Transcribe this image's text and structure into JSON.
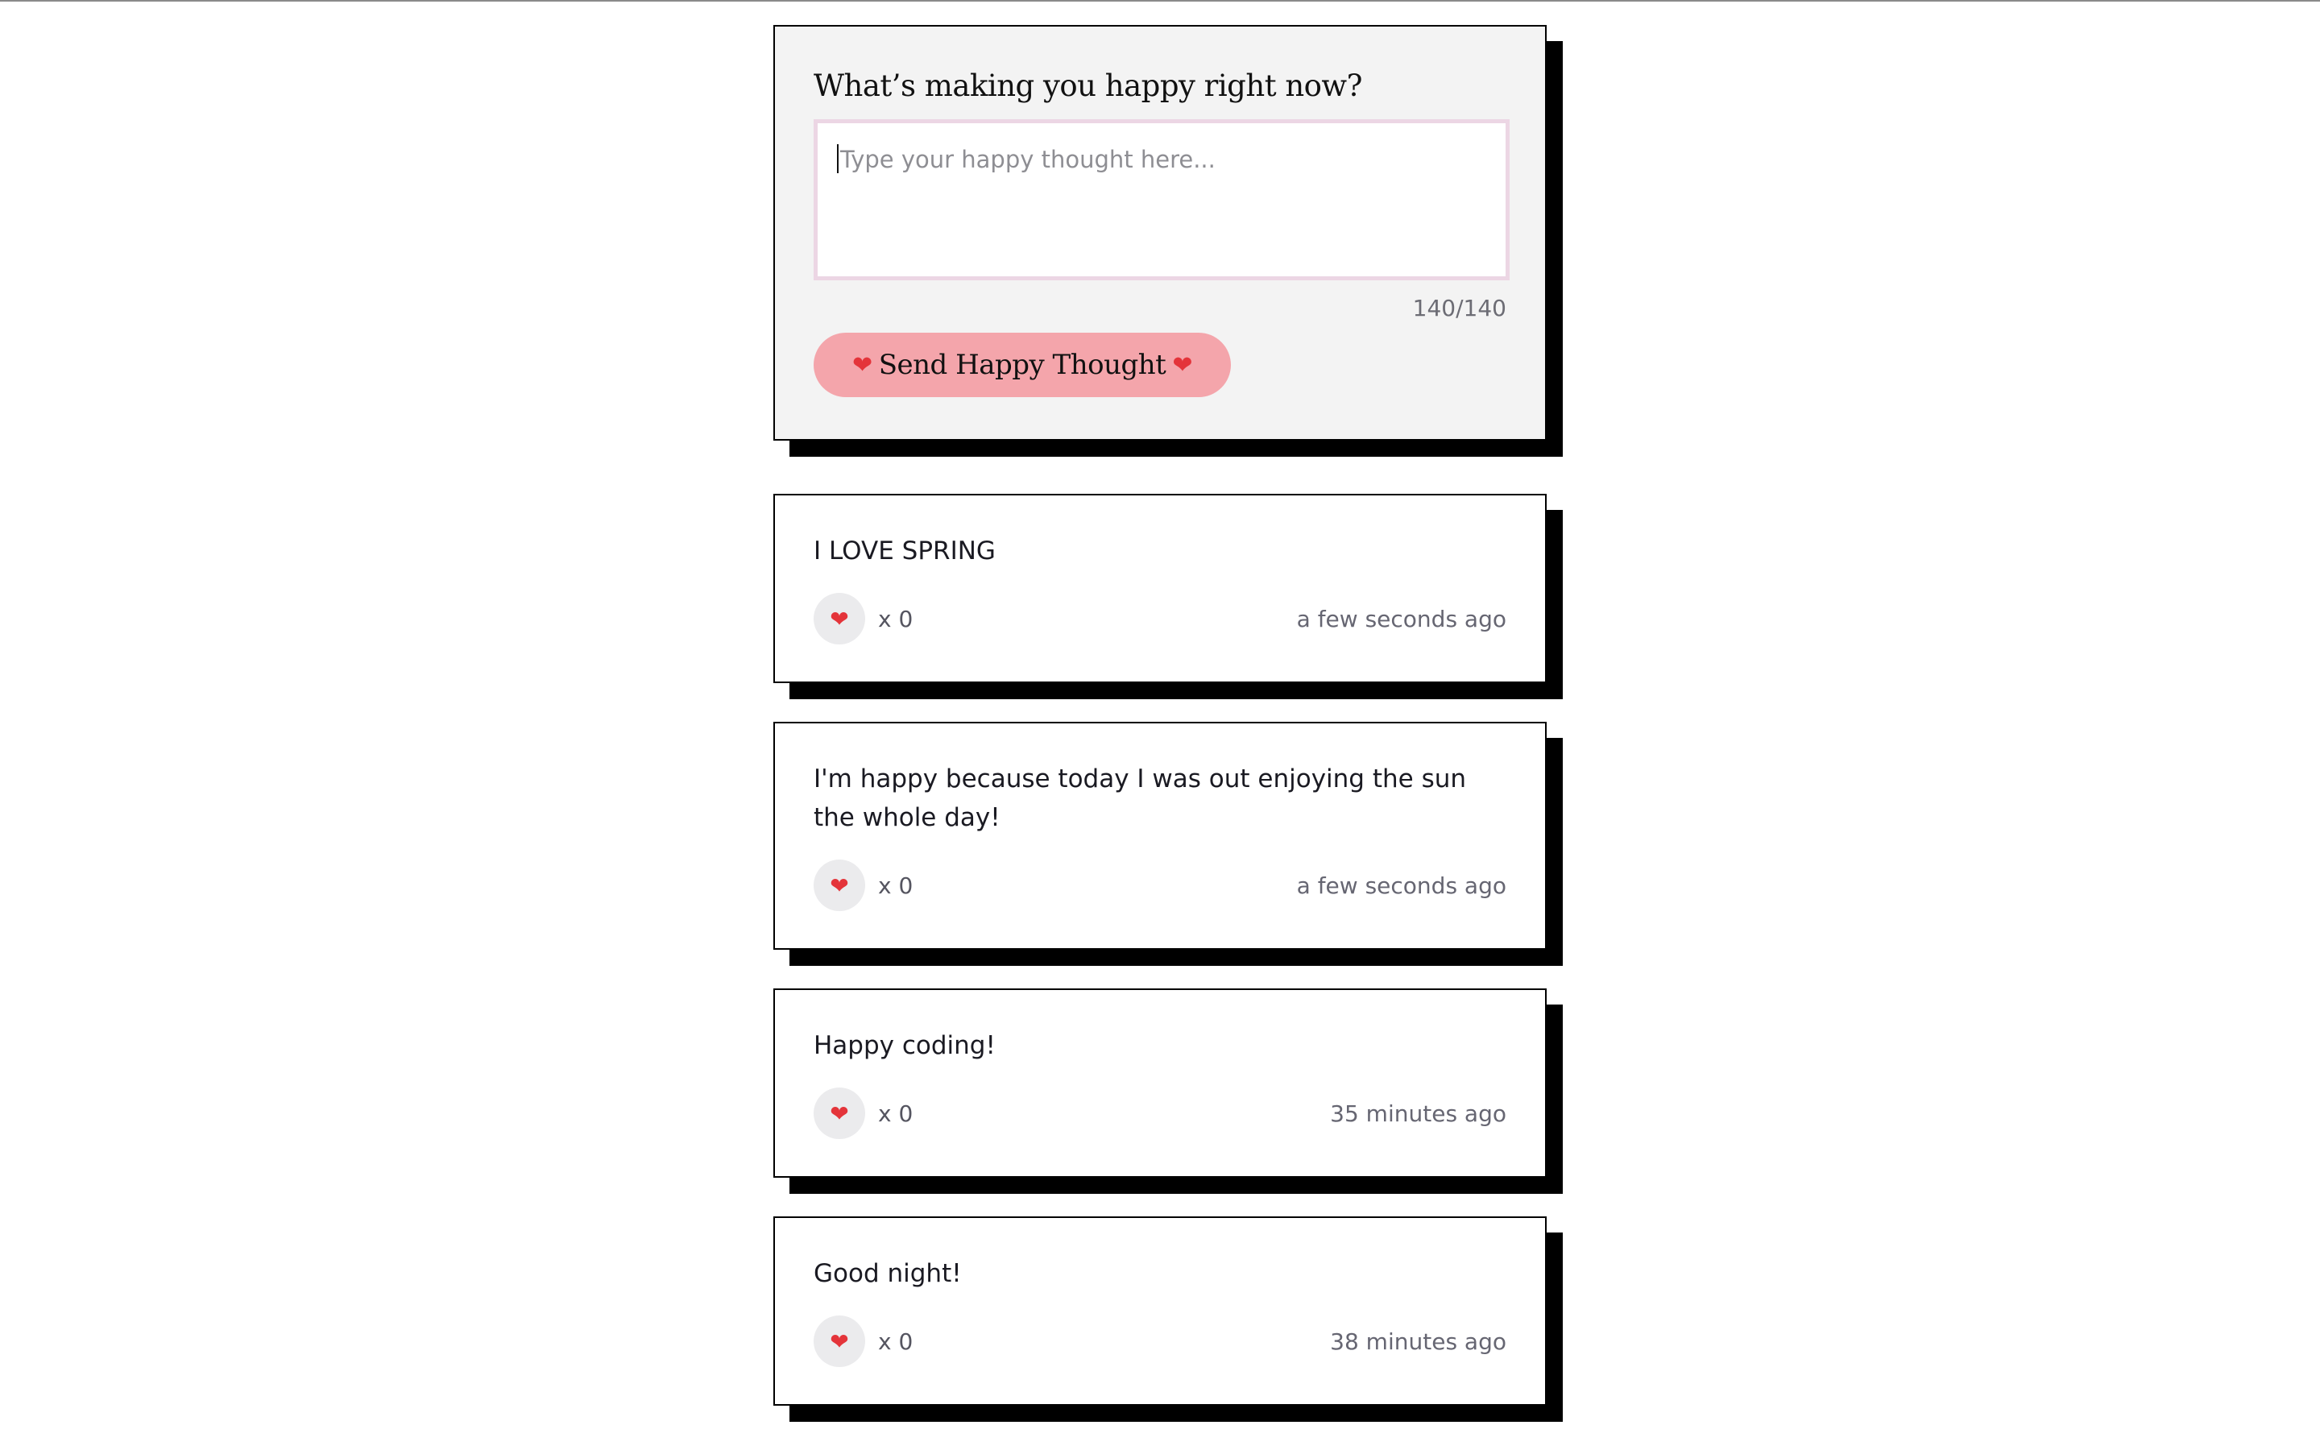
{
  "form": {
    "title": "What’s making you happy right now?",
    "textarea_placeholder": "Type your happy thought here...",
    "char_counter": "140/140",
    "send_button_label": "Send Happy Thought",
    "heart_glyph": "❤"
  },
  "thoughts": [
    {
      "message": "I LOVE SPRING",
      "likes_label": "x 0",
      "time": "a few seconds ago"
    },
    {
      "message": "I'm happy because today I was out enjoying the sun the whole day!",
      "likes_label": "x 0",
      "time": "a few seconds ago"
    },
    {
      "message": "Happy coding!",
      "likes_label": "x 0",
      "time": "35 minutes ago"
    },
    {
      "message": "Good night!",
      "likes_label": "x 0",
      "time": "38 minutes ago"
    }
  ],
  "colors": {
    "button_pink": "#f4a5ab",
    "textarea_border": "#ecd6e4",
    "form_background": "#f3f3f3",
    "heart": "#e4343a",
    "heart_button_bg": "#ebebed"
  },
  "icons": {
    "heart": "heart-icon"
  }
}
